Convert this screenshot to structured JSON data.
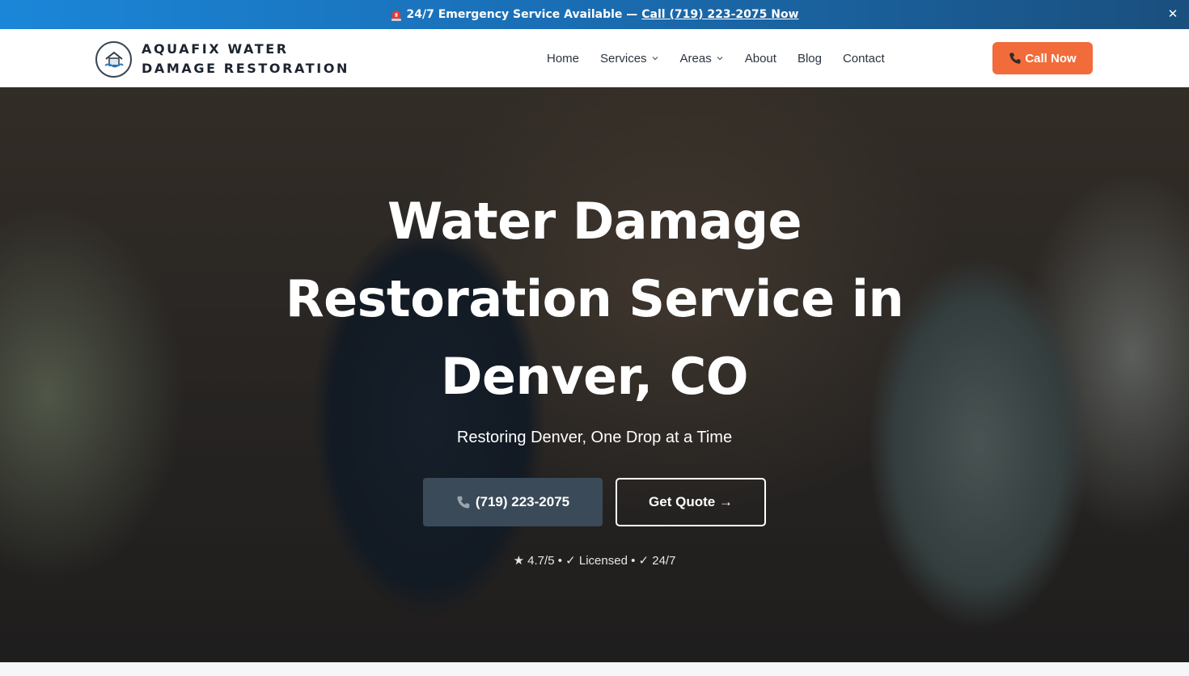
{
  "banner": {
    "text": "24/7 Emergency Service Available —",
    "link": "Call (719) 223-2075 Now",
    "siren_icon": "siren-icon",
    "close_icon": "close-icon",
    "close_glyph": "✕"
  },
  "brand": {
    "name": "AQUAFIX WATER DAMAGE RESTORATION",
    "logo_icon": "house-water-logo-icon"
  },
  "nav": {
    "items": [
      {
        "label": "Home",
        "dropdown": false
      },
      {
        "label": "Services",
        "dropdown": true
      },
      {
        "label": "Areas",
        "dropdown": true
      },
      {
        "label": "About",
        "dropdown": false
      },
      {
        "label": "Blog",
        "dropdown": false
      },
      {
        "label": "Contact",
        "dropdown": false
      }
    ],
    "cta": "Call Now"
  },
  "hero": {
    "title": "Water Damage Restoration Service in Denver, CO",
    "subtitle": "Restoring Denver, One Drop at a Time",
    "phone_button": "(719) 223-2075",
    "quote_button": "Get Quote →",
    "trust": "★ 4.7/5 • ✓ Licensed • ✓ 24/7"
  },
  "colors": {
    "banner_start": "#1b86d8",
    "banner_end": "#1a4f7e",
    "cta": "#f26b3a",
    "phone_button": "#3a4a58"
  }
}
